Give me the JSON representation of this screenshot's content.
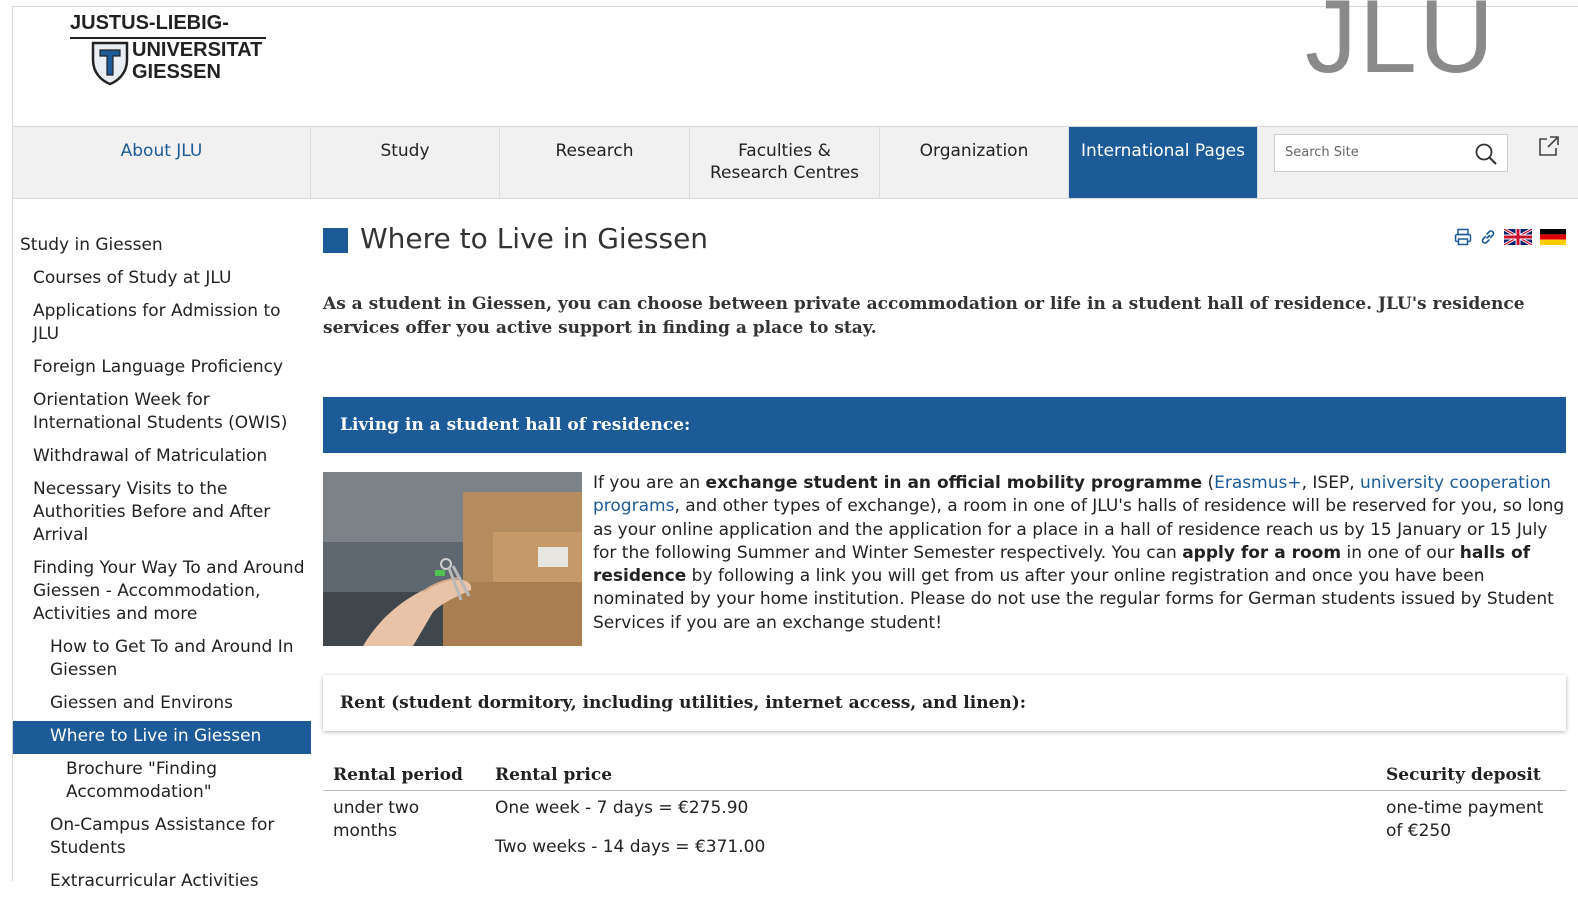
{
  "header": {
    "logo_line1": "JUSTUS-LIEBIG-",
    "logo_line2": "UNIVERSITAT",
    "logo_line3": "GIESSEN",
    "brand_mark": "JLU"
  },
  "nav": {
    "items": [
      {
        "label": "About JLU"
      },
      {
        "label": "Study"
      },
      {
        "label": "Research"
      },
      {
        "label": "Faculties & Research Centres"
      },
      {
        "label": "Organization"
      },
      {
        "label": "International Pages"
      }
    ],
    "search_placeholder": "Search Site"
  },
  "sidebar": {
    "items": [
      {
        "label": "Study in Giessen"
      },
      {
        "label": "Courses of Study at JLU"
      },
      {
        "label": "Applications for Admission to JLU"
      },
      {
        "label": "Foreign Language Proficiency"
      },
      {
        "label": "Orientation Week for International Students (OWIS)"
      },
      {
        "label": "Withdrawal of Matriculation"
      },
      {
        "label": "Necessary Visits to the Authorities Before and After Arrival"
      },
      {
        "label": "Finding Your Way To and Around Giessen - Accommodation, Activities and more"
      },
      {
        "label": "How to Get To and Around In Giessen"
      },
      {
        "label": "Giessen and Environs"
      },
      {
        "label": "Where to Live in Giessen"
      },
      {
        "label": "Brochure \"Finding Accommodation\""
      },
      {
        "label": "On-Campus Assistance for Students"
      },
      {
        "label": "Extracurricular Activities"
      }
    ]
  },
  "main": {
    "title": "Where to Live in Giessen",
    "intro": "As a student in Giessen, you can choose between private accommodation or life in a student hall of residence. JLU's residence services offer you active support in finding a place to stay.",
    "section_heading": "Living in a student hall of residence:",
    "hall": {
      "t1": "If you are an ",
      "b1": "exchange student in an official mobility programme",
      "t2": " (",
      "link1": "Erasmus+",
      "t3": ", ISEP, ",
      "link2": "university cooperation programs",
      "t4": ", and other types of exchange), a room in one of JLU's halls of residence will be reserved for you, so long as your online application and the application for a place in a hall of residence reach us by 15 January or 15 July for the following Summer and Winter Semester respectively. You can ",
      "b2": "apply for a room",
      "t5": " in one of our ",
      "b3": "halls of residence",
      "t6": " by following a link you will get from us after your online registration and once you have been nominated by your home institution. Please do not use the regular forms for German students issued by Student Services if you are an exchange student!"
    },
    "rent_heading": "Rent (student dormitory, including utilities, internet access, and linen):",
    "table": {
      "headers": [
        "Rental period",
        "Rental price",
        "Security deposit"
      ],
      "row1": {
        "period": "under two months",
        "price1": "One week - 7 days = €275.90",
        "price2": "Two weeks - 14 days = €371.00",
        "deposit": "one-time payment of €250"
      }
    }
  },
  "colors": {
    "accent": "#1c5b98"
  }
}
